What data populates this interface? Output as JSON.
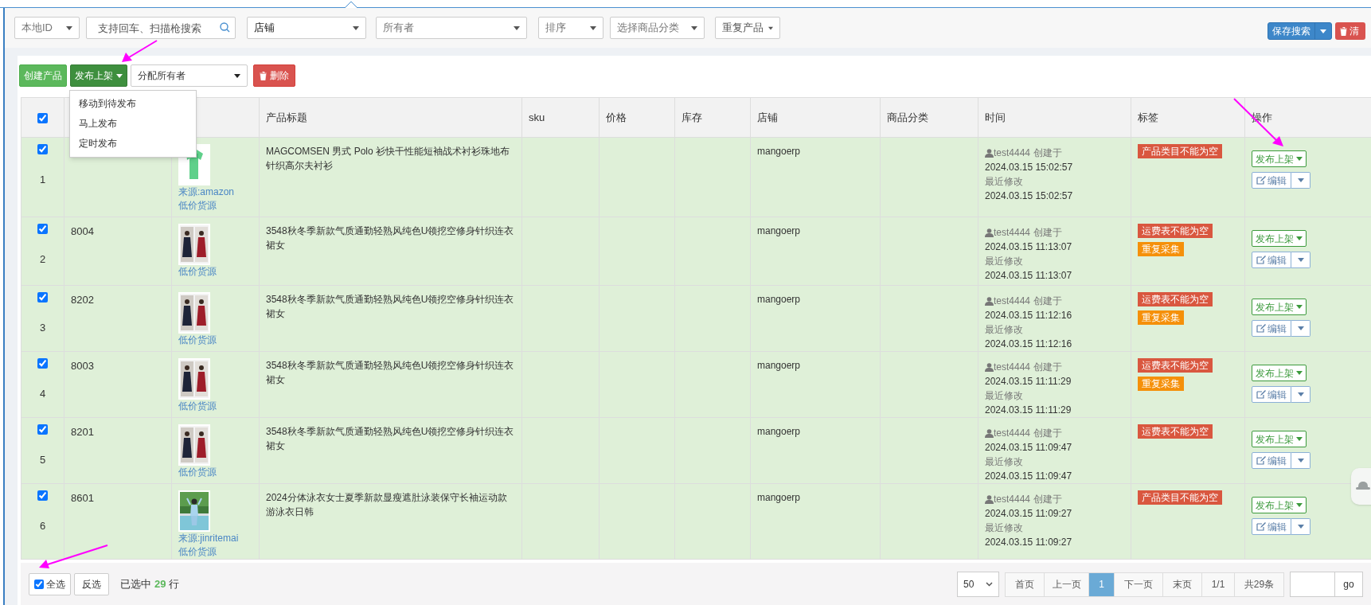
{
  "filters": [
    {
      "kind": "select",
      "placeholder": "本地ID"
    },
    {
      "kind": "search",
      "placeholder": "支持回车、扫描枪搜索"
    },
    {
      "kind": "select",
      "value": "店铺"
    },
    {
      "kind": "select",
      "placeholder": "所有者"
    },
    {
      "kind": "select",
      "placeholder": "排序"
    },
    {
      "kind": "select",
      "placeholder": "选择商品分类"
    },
    {
      "kind": "button",
      "label": "重复产品"
    }
  ],
  "search_actions": {
    "save": "保存搜索",
    "clear": "清"
  },
  "toolbar": {
    "create": "创建产品",
    "publish": "发布上架",
    "assign_placeholder": "分配所有者",
    "delete": "删除"
  },
  "publish_menu": [
    "移动到待发布",
    "马上发布",
    "定时发布"
  ],
  "table": {
    "header_checked": true,
    "columns": [
      "产品标题",
      "sku",
      "价格",
      "库存",
      "店铺",
      "商品分类",
      "时间",
      "标签",
      "操作"
    ],
    "rows": [
      {
        "checked": true,
        "index": "1",
        "source": "来源:amazon",
        "supply": "低价货源",
        "title": "MAGCOMSEN 男式 Polo 衫快干性能短袖战术衬衫珠地布针织高尔夫衬衫",
        "store": "mangoerp",
        "user": "test4444",
        "created_label": "创建于",
        "created": "2024.03.15 15:02:57",
        "modified_label": "最近修改",
        "modified": "2024.03.15 15:02:57",
        "tags": [
          {
            "text": "产品类目不能为空",
            "color": "#d9573f"
          }
        ],
        "publish": "发布上架",
        "edit": "编辑"
      },
      {
        "checked": true,
        "index": "2",
        "id": "8004",
        "supply": "低价货源",
        "title": "3548秋冬季新款气质通勤轻熟风纯色U领挖空修身针织连衣裙女",
        "store": "mangoerp",
        "user": "test4444",
        "created_label": "创建于",
        "created": "2024.03.15 11:13:07",
        "modified_label": "最近修改",
        "modified": "2024.03.15 11:13:07",
        "tags": [
          {
            "text": "运费表不能为空",
            "color": "#d9573f"
          },
          {
            "text": "重复采集",
            "color": "#f5900a"
          }
        ],
        "publish": "发布上架",
        "edit": "编辑"
      },
      {
        "checked": true,
        "index": "3",
        "id": "8202",
        "supply": "低价货源",
        "title": "3548秋冬季新款气质通勤轻熟风纯色U领挖空修身针织连衣裙女",
        "store": "mangoerp",
        "user": "test4444",
        "created_label": "创建于",
        "created": "2024.03.15 11:12:16",
        "modified_label": "最近修改",
        "modified": "2024.03.15 11:12:16",
        "tags": [
          {
            "text": "运费表不能为空",
            "color": "#d9573f"
          },
          {
            "text": "重复采集",
            "color": "#f5900a"
          }
        ],
        "publish": "发布上架",
        "edit": "编辑"
      },
      {
        "checked": true,
        "index": "4",
        "id": "8003",
        "supply": "低价货源",
        "title": "3548秋冬季新款气质通勤轻熟风纯色U领挖空修身针织连衣裙女",
        "store": "mangoerp",
        "user": "test4444",
        "created_label": "创建于",
        "created": "2024.03.15 11:11:29",
        "modified_label": "最近修改",
        "modified": "2024.03.15 11:11:29",
        "tags": [
          {
            "text": "运费表不能为空",
            "color": "#d9573f"
          },
          {
            "text": "重复采集",
            "color": "#f5900a"
          }
        ],
        "publish": "发布上架",
        "edit": "编辑"
      },
      {
        "checked": true,
        "index": "5",
        "id": "8201",
        "supply": "低价货源",
        "title": "3548秋冬季新款气质通勤轻熟风纯色U领挖空修身针织连衣裙女",
        "store": "mangoerp",
        "user": "test4444",
        "created_label": "创建于",
        "created": "2024.03.15 11:09:47",
        "modified_label": "最近修改",
        "modified": "2024.03.15 11:09:47",
        "tags": [
          {
            "text": "运费表不能为空",
            "color": "#d9573f"
          }
        ],
        "publish": "发布上架",
        "edit": "编辑"
      },
      {
        "checked": true,
        "index": "6",
        "id": "8601",
        "source": "来源:jinritemai",
        "supply": "低价货源",
        "title": "2024分体泳衣女士夏季新款显瘦遮肚泳装保守长袖运动款游泳衣日韩",
        "store": "mangoerp",
        "user": "test4444",
        "created_label": "创建于",
        "created": "2024.03.15 11:09:27",
        "modified_label": "最近修改",
        "modified": "2024.03.15 11:09:27",
        "tags": [
          {
            "text": "产品类目不能为空",
            "color": "#d9573f"
          }
        ],
        "publish": "发布上架",
        "edit": "编辑"
      }
    ]
  },
  "footer": {
    "select_all": {
      "label": "全选",
      "checked": true
    },
    "invert": "反选",
    "selected_prefix": "已选中",
    "selected_count": "29",
    "selected_suffix": "行",
    "page_size": "50",
    "pager": [
      {
        "label": "首页",
        "selected": false
      },
      {
        "label": "上一页",
        "selected": false
      },
      {
        "label": "1",
        "selected": true
      },
      {
        "label": "下一页",
        "selected": false
      },
      {
        "label": "末页",
        "selected": false
      },
      {
        "label": "1/1",
        "selected": false
      },
      {
        "label": "共29条",
        "selected": false
      }
    ],
    "go": "go"
  }
}
